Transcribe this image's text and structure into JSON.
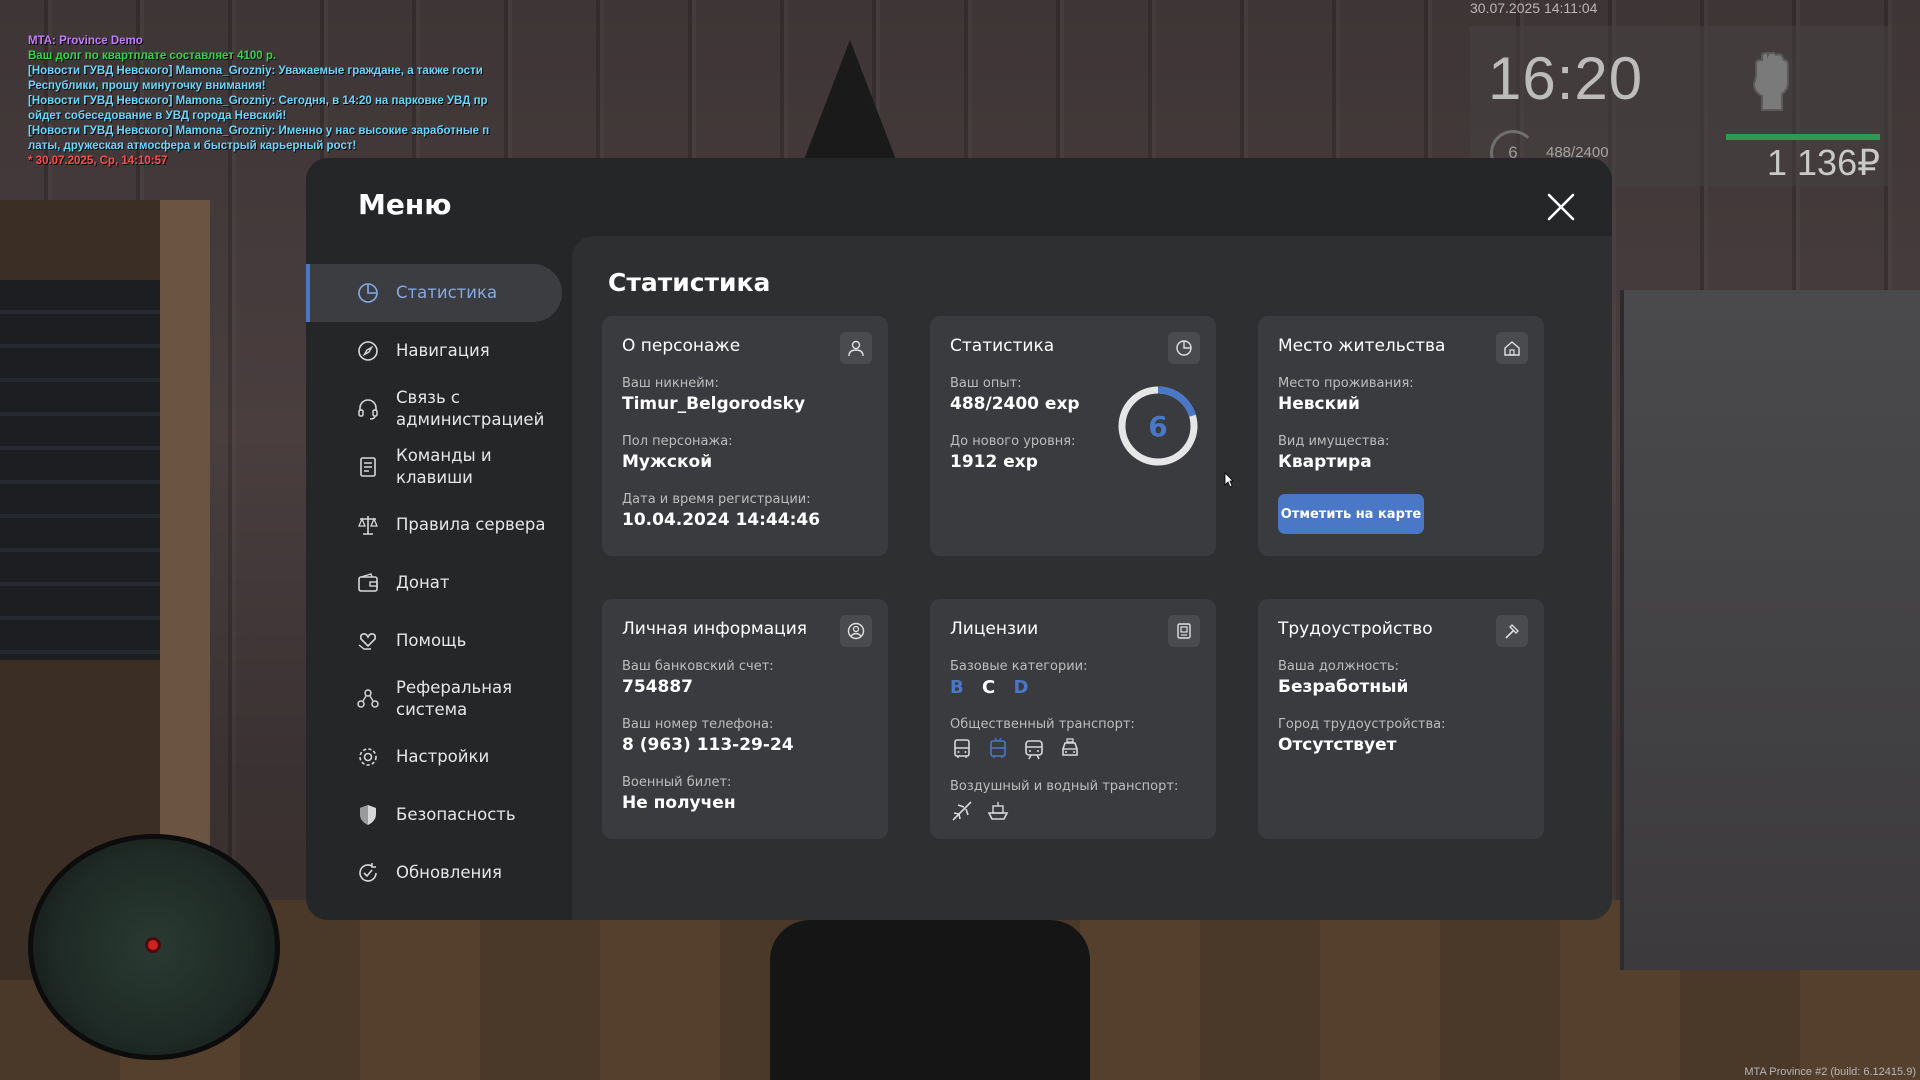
{
  "chat": [
    {
      "text": "MTA: Province Demo",
      "color": "#c77dff"
    },
    {
      "text": "Ваш долг по квартплате составляет 4100 р.",
      "color": "#33d84a"
    },
    {
      "text": "[Новости ГУВД Невского] Mamona_Grozniy: Уважаемые граждане, а также гости Республики, прошу минуточку внимания!",
      "color": "#66d9ff"
    },
    {
      "text": "[Новости ГУВД Невского] Mamona_Grozniy: Сегодня, в 14:20 на парковке УВД пр ойдет собеседование в УВД города Невский!",
      "color": "#66d9ff"
    },
    {
      "text": "[Новости ГУВД Невского] Mamona_Grozniy: Именно у нас высокие заработные п латы, дружеская атмосфера и быстрый карьерный рост!",
      "color": "#66d9ff"
    },
    {
      "text": "* 30.07.2025, Ср, 14:10:57",
      "color": "#ff4d4d"
    }
  ],
  "hud": {
    "datetime": "30.07.2025 14:11:04",
    "time": "16:20",
    "level": "6",
    "exp": "488/2400",
    "money": "1 136₽",
    "health_fraction": 1.0,
    "health_color": "#2e9a50"
  },
  "build": "MTA Province #2 (build: 6.12415.9)",
  "menu": {
    "title": "Меню",
    "close_icon": "close-icon",
    "accent": "#4a78c6",
    "nav": [
      {
        "label": "Статистика",
        "icon": "pie-chart-icon",
        "active": true
      },
      {
        "label": "Навигация",
        "icon": "compass-icon",
        "active": false
      },
      {
        "label": "Связь с администрацией",
        "icon": "headset-icon",
        "active": false
      },
      {
        "label": "Команды и клавиши",
        "icon": "document-list-icon",
        "active": false
      },
      {
        "label": "Правила сервера",
        "icon": "scales-icon",
        "active": false
      },
      {
        "label": "Донат",
        "icon": "wallet-icon",
        "active": false
      },
      {
        "label": "Помощь",
        "icon": "heart-hand-icon",
        "active": false
      },
      {
        "label": "Реферальная система",
        "icon": "people-network-icon",
        "active": false
      },
      {
        "label": "Настройки",
        "icon": "gear-icon",
        "active": false
      },
      {
        "label": "Безопасность",
        "icon": "shield-icon",
        "active": false
      },
      {
        "label": "Обновления",
        "icon": "refresh-check-icon",
        "active": false
      }
    ]
  },
  "content": {
    "title": "Статистика",
    "character": {
      "title": "О персонаже",
      "icon": "user-icon",
      "nickname_label": "Ваш никнейм:",
      "nickname": "Timur_Belgorodsky",
      "gender_label": "Пол персонажа:",
      "gender": "Мужской",
      "reg_label": "Дата и время регистрации:",
      "reg": "10.04.2024 14:44:46"
    },
    "stats": {
      "title": "Статистика",
      "icon": "clock-pie-icon",
      "exp_label": "Ваш опыт:",
      "exp": "488/2400 exp",
      "next_label": "До нового уровня:",
      "next": "1912 exp",
      "level": "6",
      "progress_fraction": 0.2033
    },
    "residence": {
      "title": "Место жительства",
      "icon": "house-icon",
      "place_label": "Место проживания:",
      "place": "Невский",
      "type_label": "Вид имущества:",
      "type": "Квартира",
      "button": "Отметить на карте"
    },
    "personal": {
      "title": "Личная информация",
      "icon": "user-circle-icon",
      "bank_label": "Ваш банковский счет:",
      "bank": "754887",
      "phone_label": "Ваш номер телефона:",
      "phone": "8 (963) 113-29-24",
      "military_label": "Военный билет:",
      "military": "Не получен"
    },
    "licenses": {
      "title": "Лицензии",
      "icon": "id-card-icon",
      "base_label": "Базовые категории:",
      "base": [
        {
          "letter": "B",
          "color": "#4a78c6"
        },
        {
          "letter": "C",
          "color": "#ffffff"
        },
        {
          "letter": "D",
          "color": "#4a78c6"
        }
      ],
      "public_label": "Общественный транспорт:",
      "public_icons": [
        {
          "name": "bus-icon",
          "color": "#d8d8d8"
        },
        {
          "name": "trolleybus-icon",
          "color": "#4a78c6"
        },
        {
          "name": "tram-icon",
          "color": "#d8d8d8"
        },
        {
          "name": "taxi-icon",
          "color": "#d8d8d8"
        }
      ],
      "air_label": "Воздушный и водный транспорт:",
      "air_icons": [
        {
          "name": "plane-icon",
          "color": "#d8d8d8"
        },
        {
          "name": "boat-icon",
          "color": "#d8d8d8"
        }
      ]
    },
    "employment": {
      "title": "Трудоустройство",
      "icon": "hammer-icon",
      "position_label": "Ваша должность:",
      "position": "Безработный",
      "city_label": "Город трудоустройства:",
      "city": "Отсутствует"
    }
  }
}
